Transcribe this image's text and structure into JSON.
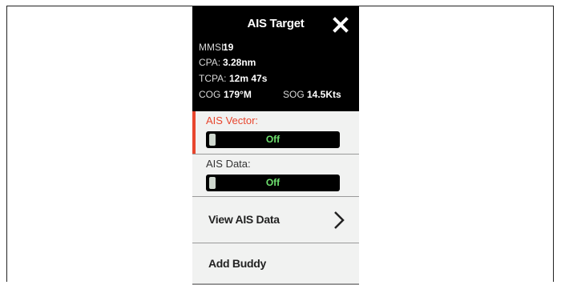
{
  "panel": {
    "title": "AIS Target",
    "close_icon": "close-icon",
    "rows": {
      "mmsi_label": "MMSI:",
      "mmsi_value": "19",
      "cpa_label": "CPA:",
      "cpa_value": "3.28nm",
      "tcpa_label": "TCPA:",
      "tcpa_value": "12m 47s",
      "cog_label": "COG",
      "cog_value": "179°M",
      "sog_label": "SOG",
      "sog_value": "14.5Kts"
    },
    "ais_vector": {
      "label": "AIS Vector:",
      "state": "Off"
    },
    "ais_data": {
      "label": "AIS Data:",
      "state": "Off"
    },
    "menu": {
      "view_ais_data": "View AIS Data",
      "add_buddy": "Add Buddy"
    },
    "colors": {
      "accent": "#e8462e",
      "toggle_text": "#6fe16f",
      "header_bg": "#000000",
      "panel_bg": "#f1f2f1"
    }
  }
}
